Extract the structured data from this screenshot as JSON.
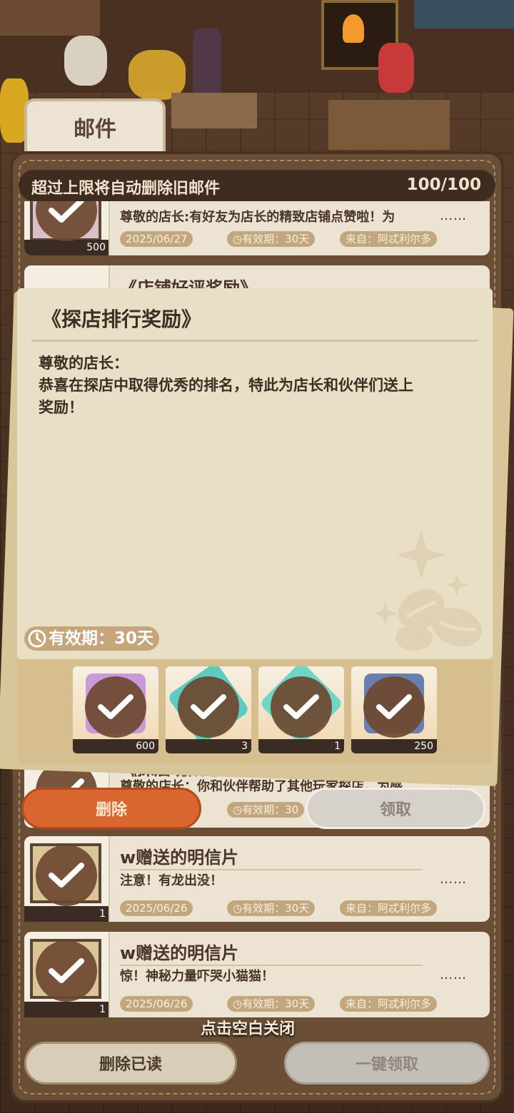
{
  "mail_panel": {
    "tab_title": "邮件",
    "header_notice": "超过上限将自动删除旧邮件",
    "capacity": "100/100"
  },
  "mail_list": [
    {
      "title": "",
      "preview": "尊敬的店长:有好友为店长的精致店铺点赞啦！为",
      "dots": "……",
      "date": "2025/06/27",
      "validity": "有效期：30天",
      "sender": "来自：阿忒利尔多",
      "attachment_count": "500"
    },
    {
      "title": "《店铺好评奖励》",
      "preview": "",
      "dots": "",
      "date": "",
      "validity": "",
      "sender": "",
      "attachment_count": ""
    },
    {
      "title": "《探店功成感谢酬金》",
      "preview": "尊敬的店长：你和伙伴帮助了其他玩家探店，为感",
      "dots": "……",
      "date": "",
      "validity": "有效期：30",
      "sender": "",
      "attachment_count": ""
    },
    {
      "title": "w赠送的明信片",
      "preview": "注意！有龙出没！",
      "dots": "……",
      "date": "2025/06/26",
      "validity": "有效期：30天",
      "sender": "来自：阿忒利尔多",
      "attachment_count": "1"
    },
    {
      "title": "w赠送的明信片",
      "preview": "惊！神秘力量吓哭小猫猫！",
      "dots": "……",
      "date": "2025/06/26",
      "validity": "有效期：30天",
      "sender": "来自：阿忒利尔多",
      "attachment_count": "1"
    }
  ],
  "popup": {
    "title": "《探店排行奖励》",
    "body_lines": [
      "尊敬的店长：",
      "恭喜在探店中取得优秀的排名，特此为店长和伙伴们送上",
      "奖励！"
    ],
    "validity": "有效期：30天",
    "rewards": [
      {
        "count": "600",
        "color": "#c79ad8",
        "icon": "character-card"
      },
      {
        "count": "3",
        "color": "#5ccbc0",
        "icon": "coin-item"
      },
      {
        "count": "1",
        "color": "#6fd6c6",
        "icon": "gem-item"
      },
      {
        "count": "250",
        "color": "#6a7fb0",
        "icon": "box-item"
      }
    ]
  },
  "buttons": {
    "delete": "删除",
    "claim": "领取",
    "delete_read": "删除已读",
    "claim_all": "一键领取"
  },
  "close_hint": "点击空白关闭",
  "colors": {
    "accent_orange": "#d9662e",
    "card": "#ece3d3",
    "frame": "#6b4e36",
    "check": "#6e4830"
  }
}
